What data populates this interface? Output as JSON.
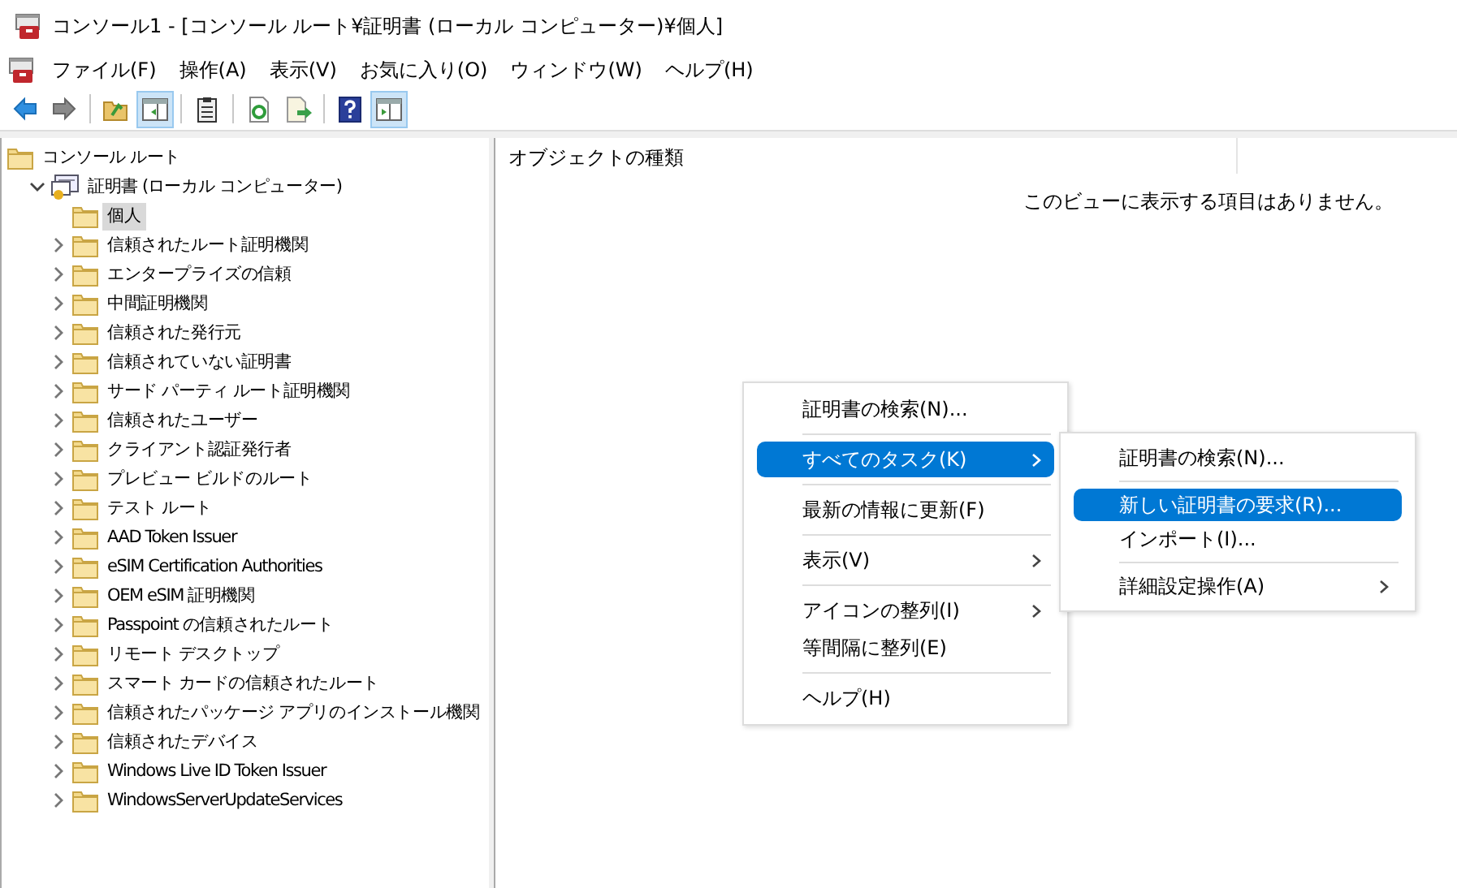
{
  "window": {
    "title": "コンソール1 - [コンソール ルート¥証明書 (ローカル コンピューター)¥個人]"
  },
  "menu_bar": [
    "ファイル(F)",
    "操作(A)",
    "表示(V)",
    "お気に入り(O)",
    "ウィンドウ(W)",
    "ヘルプ(H)"
  ],
  "toolbar": [
    {
      "kind": "back",
      "pressed": false
    },
    {
      "kind": "forward",
      "pressed": false
    },
    {
      "kind": "separator"
    },
    {
      "kind": "up",
      "pressed": false
    },
    {
      "kind": "tree",
      "pressed": true
    },
    {
      "kind": "separator"
    },
    {
      "kind": "clipboard",
      "pressed": false
    },
    {
      "kind": "separator"
    },
    {
      "kind": "refresh",
      "pressed": false
    },
    {
      "kind": "export",
      "pressed": false
    },
    {
      "kind": "separator"
    },
    {
      "kind": "help",
      "pressed": false
    },
    {
      "kind": "actions",
      "pressed": true
    }
  ],
  "tree": [
    {
      "label": "コンソール ルート",
      "kind": "folder",
      "selected": false,
      "children": [
        {
          "label": "証明書 (ローカル コンピューター)",
          "kind": "certificate",
          "expanded": true,
          "selected": false,
          "children": [
            {
              "label": "個人",
              "kind": "folder",
              "expandable": false,
              "selected": true
            },
            {
              "label": "信頼されたルート証明機関",
              "kind": "folder",
              "expandable": true,
              "selected": false
            },
            {
              "label": "エンタープライズの信頼",
              "kind": "folder",
              "expandable": true,
              "selected": false
            },
            {
              "label": "中間証明機関",
              "kind": "folder",
              "expandable": true,
              "selected": false
            },
            {
              "label": "信頼された発行元",
              "kind": "folder",
              "expandable": true,
              "selected": false
            },
            {
              "label": "信頼されていない証明書",
              "kind": "folder",
              "expandable": true,
              "selected": false
            },
            {
              "label": "サード パーティ ルート証明機関",
              "kind": "folder",
              "expandable": true,
              "selected": false
            },
            {
              "label": "信頼されたユーザー",
              "kind": "folder",
              "expandable": true,
              "selected": false
            },
            {
              "label": "クライアント認証発行者",
              "kind": "folder",
              "expandable": true,
              "selected": false
            },
            {
              "label": "プレビュー ビルドのルート",
              "kind": "folder",
              "expandable": true,
              "selected": false
            },
            {
              "label": "テスト ルート",
              "kind": "folder",
              "expandable": true,
              "selected": false
            },
            {
              "label": "AAD Token Issuer",
              "kind": "folder",
              "expandable": true,
              "selected": false
            },
            {
              "label": "eSIM Certification Authorities",
              "kind": "folder",
              "expandable": true,
              "selected": false
            },
            {
              "label": "OEM eSIM 証明機関",
              "kind": "folder",
              "expandable": true,
              "selected": false
            },
            {
              "label": "Passpoint の信頼されたルート",
              "kind": "folder",
              "expandable": true,
              "selected": false
            },
            {
              "label": "リモート デスクトップ",
              "kind": "folder",
              "expandable": true,
              "selected": false
            },
            {
              "label": "スマート カードの信頼されたルート",
              "kind": "folder",
              "expandable": true,
              "selected": false
            },
            {
              "label": "信頼されたパッケージ アプリのインストール機関",
              "kind": "folder",
              "expandable": true,
              "selected": false
            },
            {
              "label": "信頼されたデバイス",
              "kind": "folder",
              "expandable": true,
              "selected": false
            },
            {
              "label": "Windows Live ID Token Issuer",
              "kind": "folder",
              "expandable": true,
              "selected": false
            },
            {
              "label": "WindowsServerUpdateServices",
              "kind": "folder",
              "expandable": true,
              "selected": false
            }
          ]
        }
      ]
    }
  ],
  "list": {
    "columns": [
      "オブジェクトの種類"
    ],
    "empty_message": "このビューに表示する項目はありません。"
  },
  "context_menu": {
    "groups": [
      [
        {
          "label": "証明書の検索(N)...",
          "submenu": false,
          "selected": false
        }
      ],
      [
        {
          "label": "すべてのタスク(K)",
          "submenu": true,
          "selected": true
        }
      ],
      [
        {
          "label": "最新の情報に更新(F)",
          "submenu": false,
          "selected": false
        }
      ],
      [
        {
          "label": "表示(V)",
          "submenu": true,
          "selected": false
        }
      ],
      [
        {
          "label": "アイコンの整列(I)",
          "submenu": true,
          "selected": false
        },
        {
          "label": "等間隔に整列(E)",
          "submenu": false,
          "selected": false
        }
      ],
      [
        {
          "label": "ヘルプ(H)",
          "submenu": false,
          "selected": false
        }
      ]
    ]
  },
  "submenu": {
    "groups": [
      [
        {
          "label": "証明書の検索(N)...",
          "submenu": false,
          "selected": false
        }
      ],
      [
        {
          "label": "新しい証明書の要求(R)...",
          "submenu": false,
          "selected": true
        },
        {
          "label": "インポート(I)...",
          "submenu": false,
          "selected": false
        }
      ],
      [
        {
          "label": "詳細設定操作(A)",
          "submenu": true,
          "selected": false
        }
      ]
    ]
  }
}
